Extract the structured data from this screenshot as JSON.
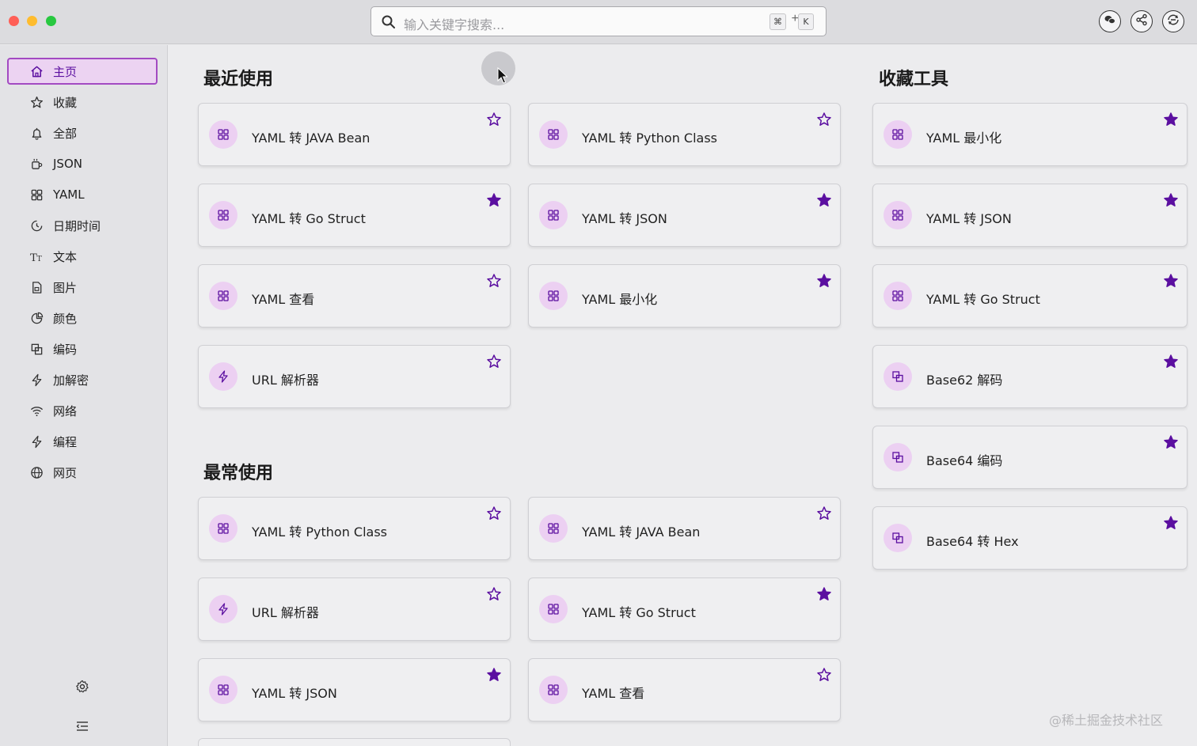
{
  "window": {
    "traffic_lights": [
      "close",
      "minimize",
      "zoom"
    ]
  },
  "search": {
    "placeholder": "输入关键字搜索...",
    "shortcut_key1": "⌘",
    "shortcut_plus": "+",
    "shortcut_key2": "K"
  },
  "toolbar": {
    "buttons": [
      "wechat-icon",
      "share-icon",
      "sync-icon"
    ]
  },
  "sidebar": {
    "items": [
      {
        "label": "主页",
        "icon": "home-icon",
        "active": true
      },
      {
        "label": "收藏",
        "icon": "star-icon"
      },
      {
        "label": "全部",
        "icon": "bell-icon"
      },
      {
        "label": "JSON",
        "icon": "cup-icon"
      },
      {
        "label": "YAML",
        "icon": "grid-icon"
      },
      {
        "label": "日期时间",
        "icon": "clock-icon"
      },
      {
        "label": "文本",
        "icon": "text-icon"
      },
      {
        "label": "图片",
        "icon": "image-file-icon"
      },
      {
        "label": "颜色",
        "icon": "pie-icon"
      },
      {
        "label": "编码",
        "icon": "copy-icon"
      },
      {
        "label": "加解密",
        "icon": "bolt-icon"
      },
      {
        "label": "网络",
        "icon": "wifi-icon"
      },
      {
        "label": "编程",
        "icon": "bolt-icon"
      },
      {
        "label": "网页",
        "icon": "globe-icon"
      }
    ],
    "bottom": [
      "settings-icon",
      "menu-collapse-icon"
    ]
  },
  "recent": {
    "title": "最近使用",
    "cards": [
      {
        "label": "YAML 转 JAVA Bean",
        "icon": "grid-icon",
        "starred": false
      },
      {
        "label": "YAML 转 Python Class",
        "icon": "grid-icon",
        "starred": false
      },
      {
        "label": "YAML 转 Go Struct",
        "icon": "grid-icon",
        "starred": true
      },
      {
        "label": "YAML 转 JSON",
        "icon": "grid-icon",
        "starred": true
      },
      {
        "label": "YAML 查看",
        "icon": "grid-icon",
        "starred": false
      },
      {
        "label": "YAML 最小化",
        "icon": "grid-icon",
        "starred": true
      },
      {
        "label": "URL 解析器",
        "icon": "bolt-icon",
        "starred": false
      }
    ]
  },
  "frequent": {
    "title": "最常使用",
    "cards": [
      {
        "label": "YAML 转 Python Class",
        "icon": "grid-icon",
        "starred": false
      },
      {
        "label": "YAML 转 JAVA Bean",
        "icon": "grid-icon",
        "starred": false
      },
      {
        "label": "URL 解析器",
        "icon": "bolt-icon",
        "starred": false
      },
      {
        "label": "YAML 转 Go Struct",
        "icon": "grid-icon",
        "starred": true
      },
      {
        "label": "YAML 转 JSON",
        "icon": "grid-icon",
        "starred": true
      },
      {
        "label": "YAML 查看",
        "icon": "grid-icon",
        "starred": false
      }
    ]
  },
  "favorites": {
    "title": "收藏工具",
    "cards": [
      {
        "label": "YAML 最小化",
        "icon": "grid-icon",
        "starred": true
      },
      {
        "label": "YAML 转 JSON",
        "icon": "grid-icon",
        "starred": true
      },
      {
        "label": "YAML 转 Go Struct",
        "icon": "grid-icon",
        "starred": true
      },
      {
        "label": "Base62 解码",
        "icon": "copy-icon",
        "starred": true
      },
      {
        "label": "Base64 编码",
        "icon": "copy-icon",
        "starred": true
      },
      {
        "label": "Base64 转 Hex",
        "icon": "copy-icon",
        "starred": true
      }
    ]
  },
  "watermark": "@稀土掘金技术社区",
  "colors": {
    "accent": "#5b0fa0",
    "active_bg": "#ecd3f2",
    "icon_bg": "#ecd0f2"
  }
}
